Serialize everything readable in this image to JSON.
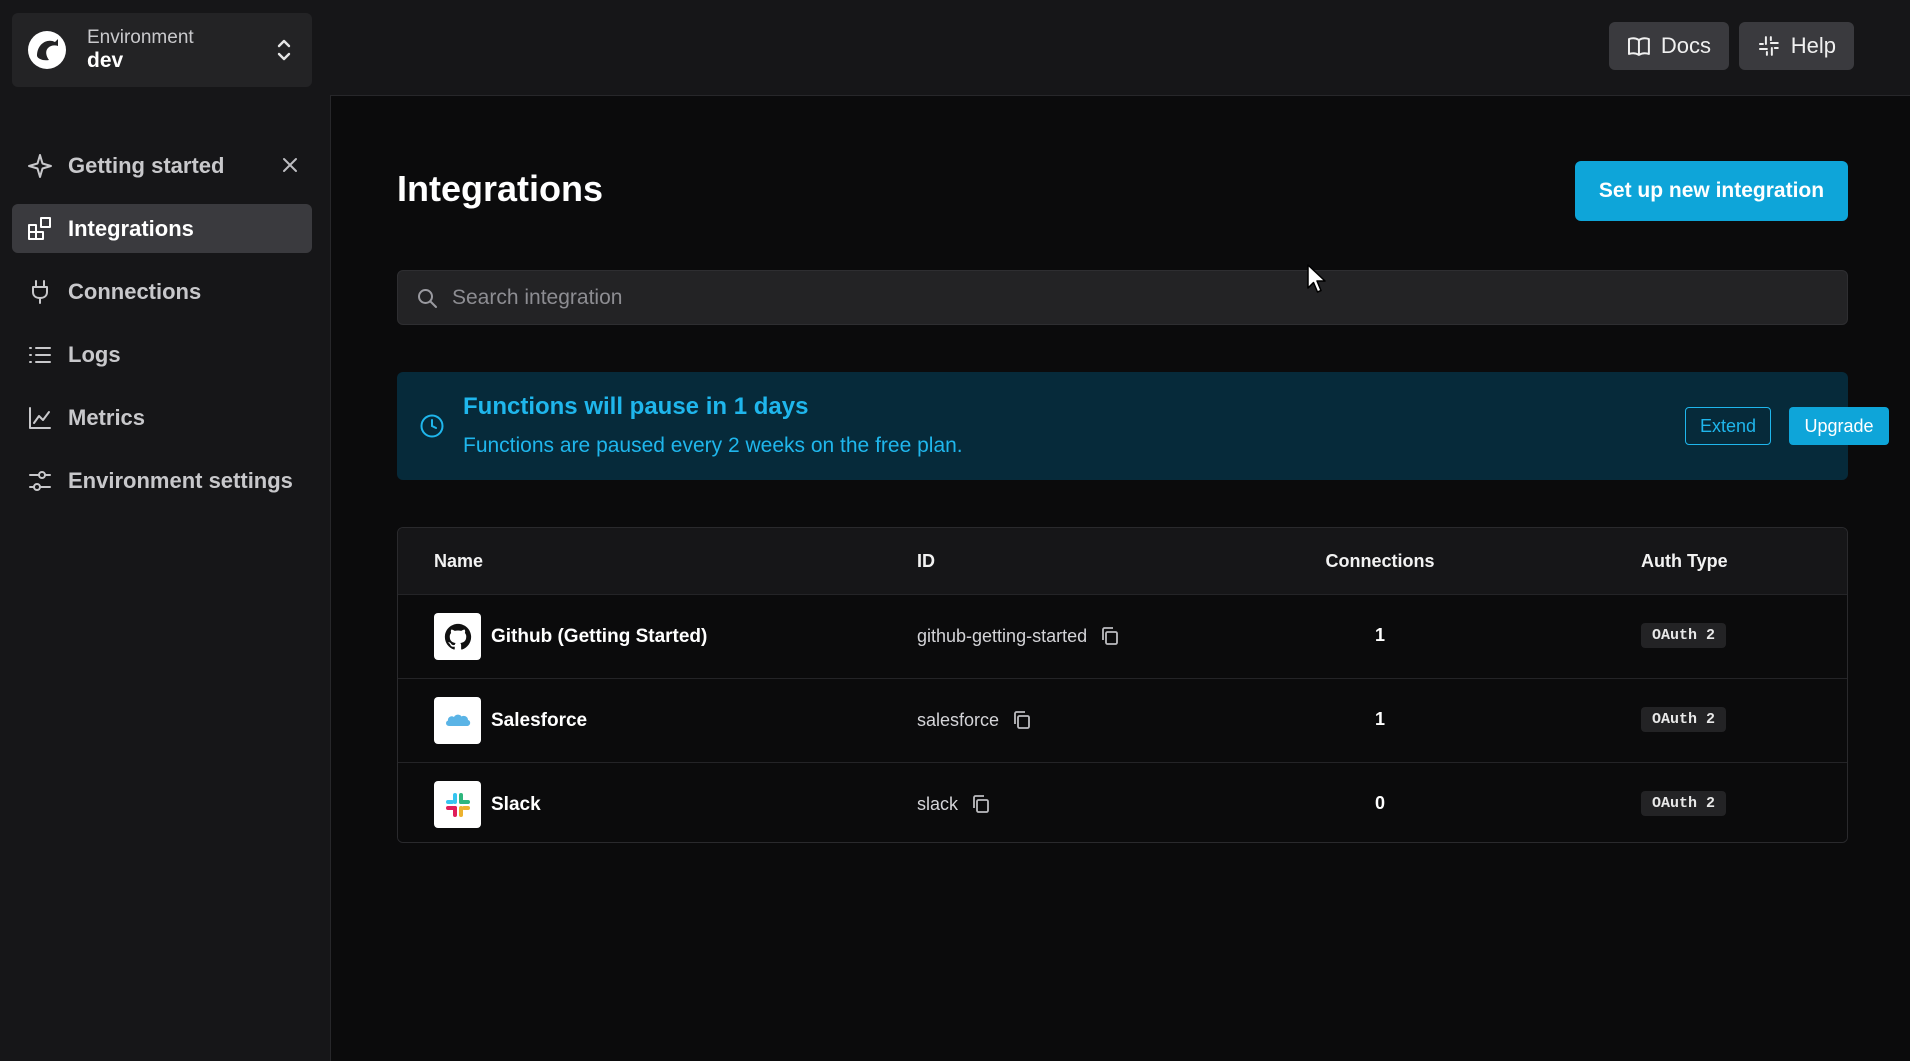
{
  "environment": {
    "label": "Environment",
    "name": "dev"
  },
  "sidebar": {
    "items": [
      {
        "label": "Getting started",
        "icon": "sparkle-icon"
      },
      {
        "label": "Integrations",
        "icon": "integrations-icon"
      },
      {
        "label": "Connections",
        "icon": "plug-icon"
      },
      {
        "label": "Logs",
        "icon": "list-icon"
      },
      {
        "label": "Metrics",
        "icon": "chart-icon"
      },
      {
        "label": "Environment settings",
        "icon": "sliders-icon"
      }
    ]
  },
  "topbar": {
    "docs_label": "Docs",
    "help_label": "Help"
  },
  "main": {
    "title": "Integrations",
    "new_button": "Set up new integration",
    "search_placeholder": "Search integration"
  },
  "banner": {
    "title": "Functions will pause in 1 days",
    "text": "Functions are paused every 2 weeks on the free plan.",
    "extend_label": "Extend",
    "upgrade_label": "Upgrade"
  },
  "table": {
    "headers": {
      "name": "Name",
      "id": "ID",
      "connections": "Connections",
      "auth": "Auth Type"
    },
    "rows": [
      {
        "name": "Github (Getting Started)",
        "id": "github-getting-started",
        "connections": "1",
        "auth": "OAuth 2",
        "logo": "github-logo-icon"
      },
      {
        "name": "Salesforce",
        "id": "salesforce",
        "connections": "1",
        "auth": "OAuth 2",
        "logo": "salesforce-logo-icon"
      },
      {
        "name": "Slack",
        "id": "slack",
        "connections": "0",
        "auth": "OAuth 2",
        "logo": "slack-logo-icon"
      }
    ]
  },
  "colors": {
    "accent": "#0ea5d9",
    "banner_bg": "#062a3a",
    "banner_text": "#1fb6ec",
    "active_nav": "#3a3a3e"
  }
}
